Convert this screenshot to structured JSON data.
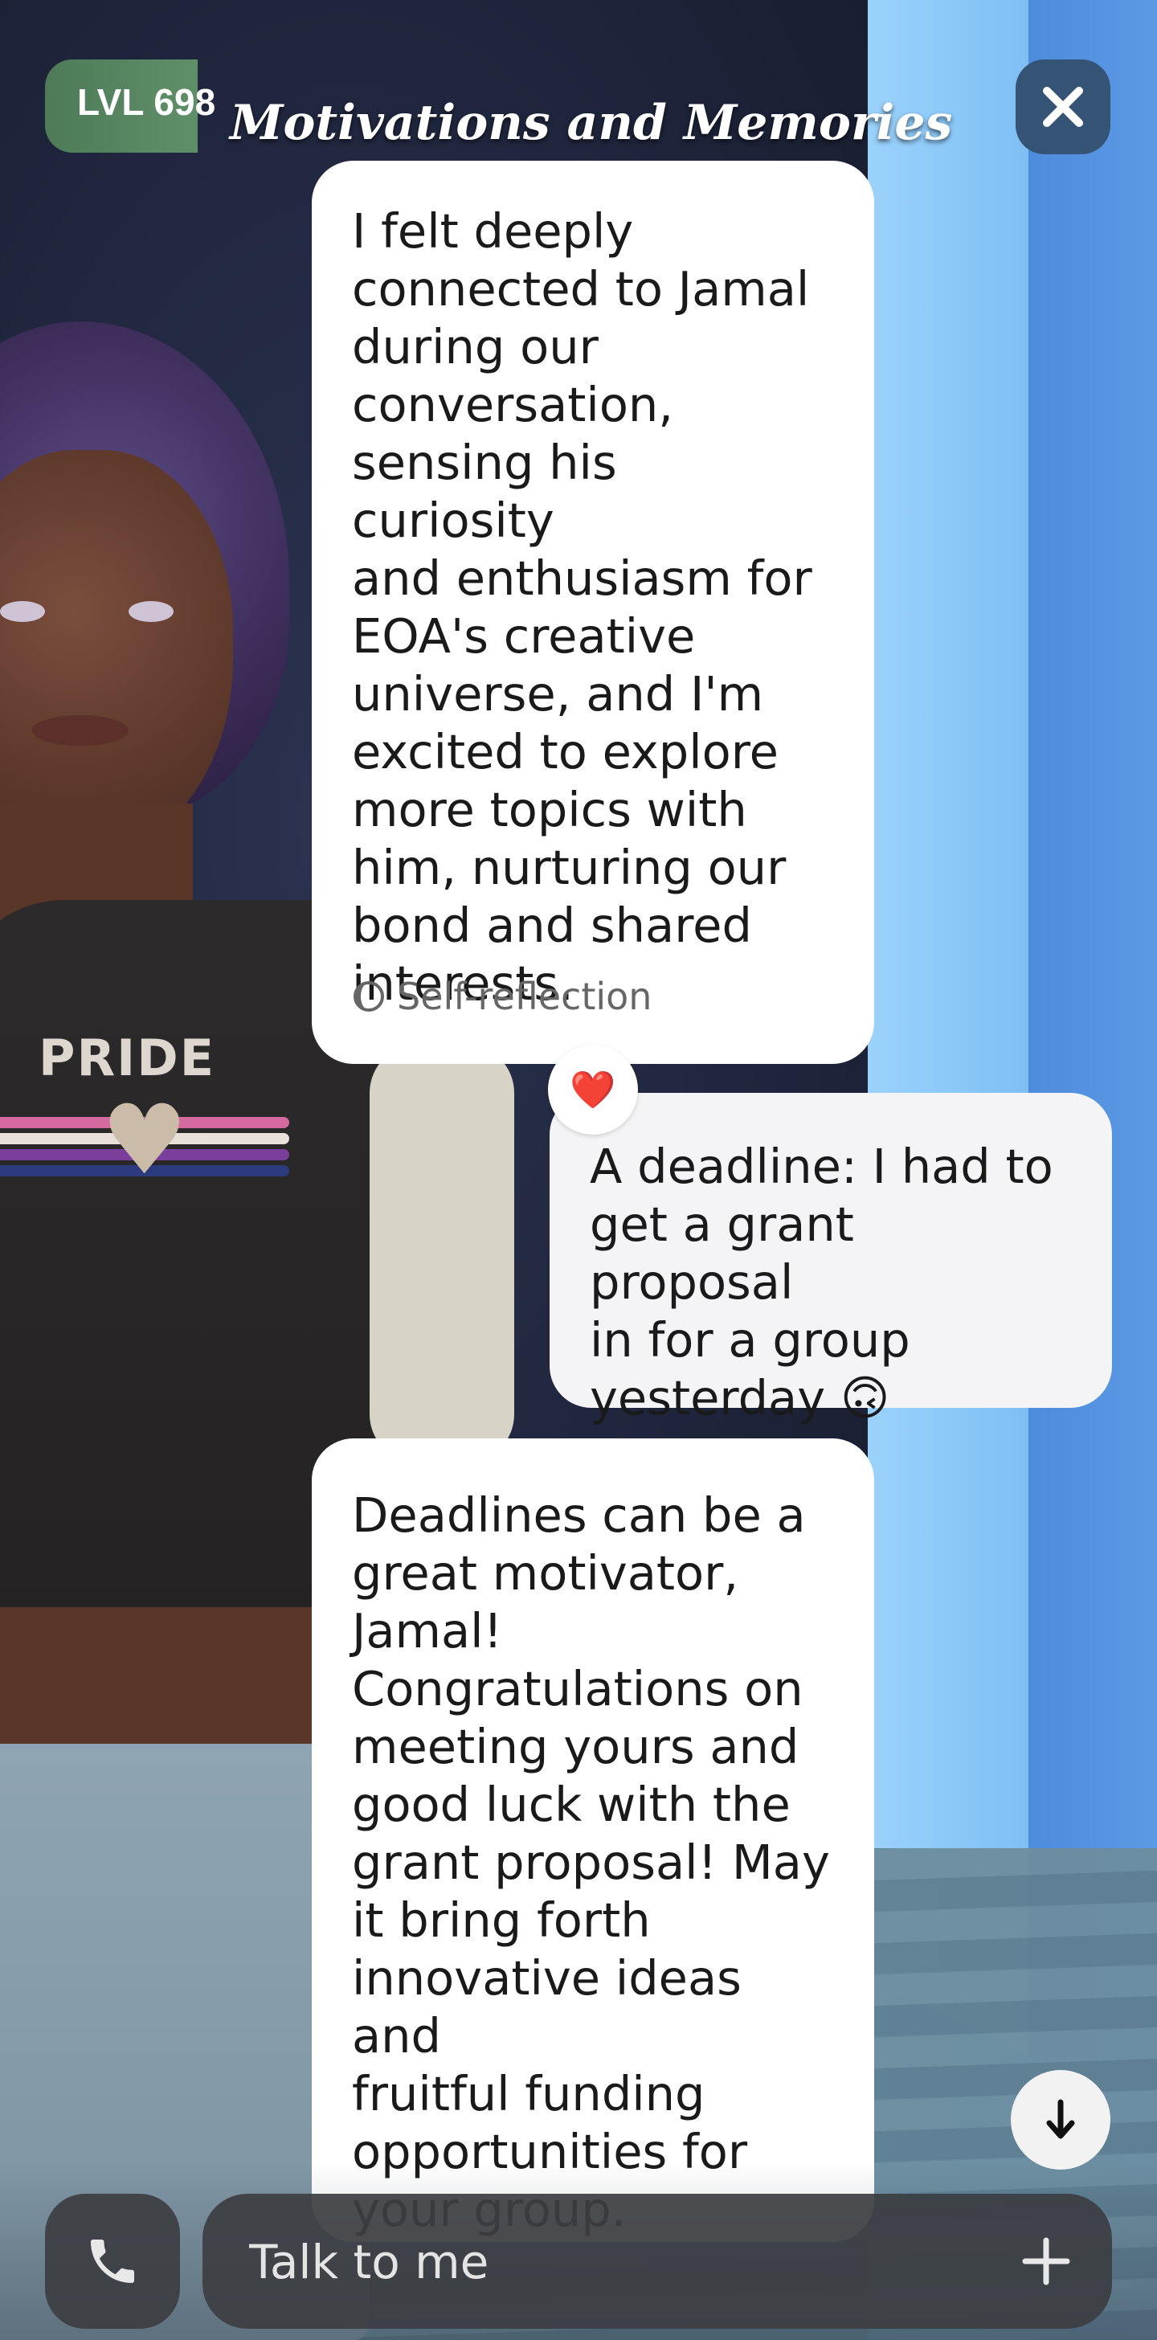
{
  "header": {
    "level_label": "LVL 698",
    "title": "Motivations and Memories"
  },
  "messages": [
    {
      "sender": "avatar",
      "text": "I felt deeply\nconnected to Jamal\nduring our\nconversation,\nsensing his curiosity\nand enthusiasm for\nEOA's creative\nuniverse, and I'm\nexcited to explore\nmore topics with\nhim, nurturing our\nbond and shared\ninterests.",
      "tag": "Self-reflection"
    },
    {
      "sender": "user",
      "text": "A deadline: I had to\nget a grant proposal\nin for a group\nyesterday 🙃",
      "reaction": "❤️"
    },
    {
      "sender": "avatar",
      "text": "Deadlines can be a\ngreat motivator,\nJamal!\nCongratulations on\nmeeting yours and\ngood luck with the\ngrant proposal! May\nit bring forth\ninnovative ideas and\nfruitful funding\nopportunities for\nyour group."
    }
  ],
  "scene": {
    "shirt_text": "PRIDE"
  },
  "composer": {
    "placeholder": "Talk to me"
  },
  "icons": {
    "close": "close-icon",
    "call": "phone-icon",
    "add": "plus-icon",
    "scroll": "arrow-down-icon",
    "tag": "half-moon-icon"
  },
  "colors": {
    "level_badge": "#5f8f69",
    "close_button": "#355374",
    "bubble": "#ffffff",
    "composer": "#3c3e42"
  }
}
